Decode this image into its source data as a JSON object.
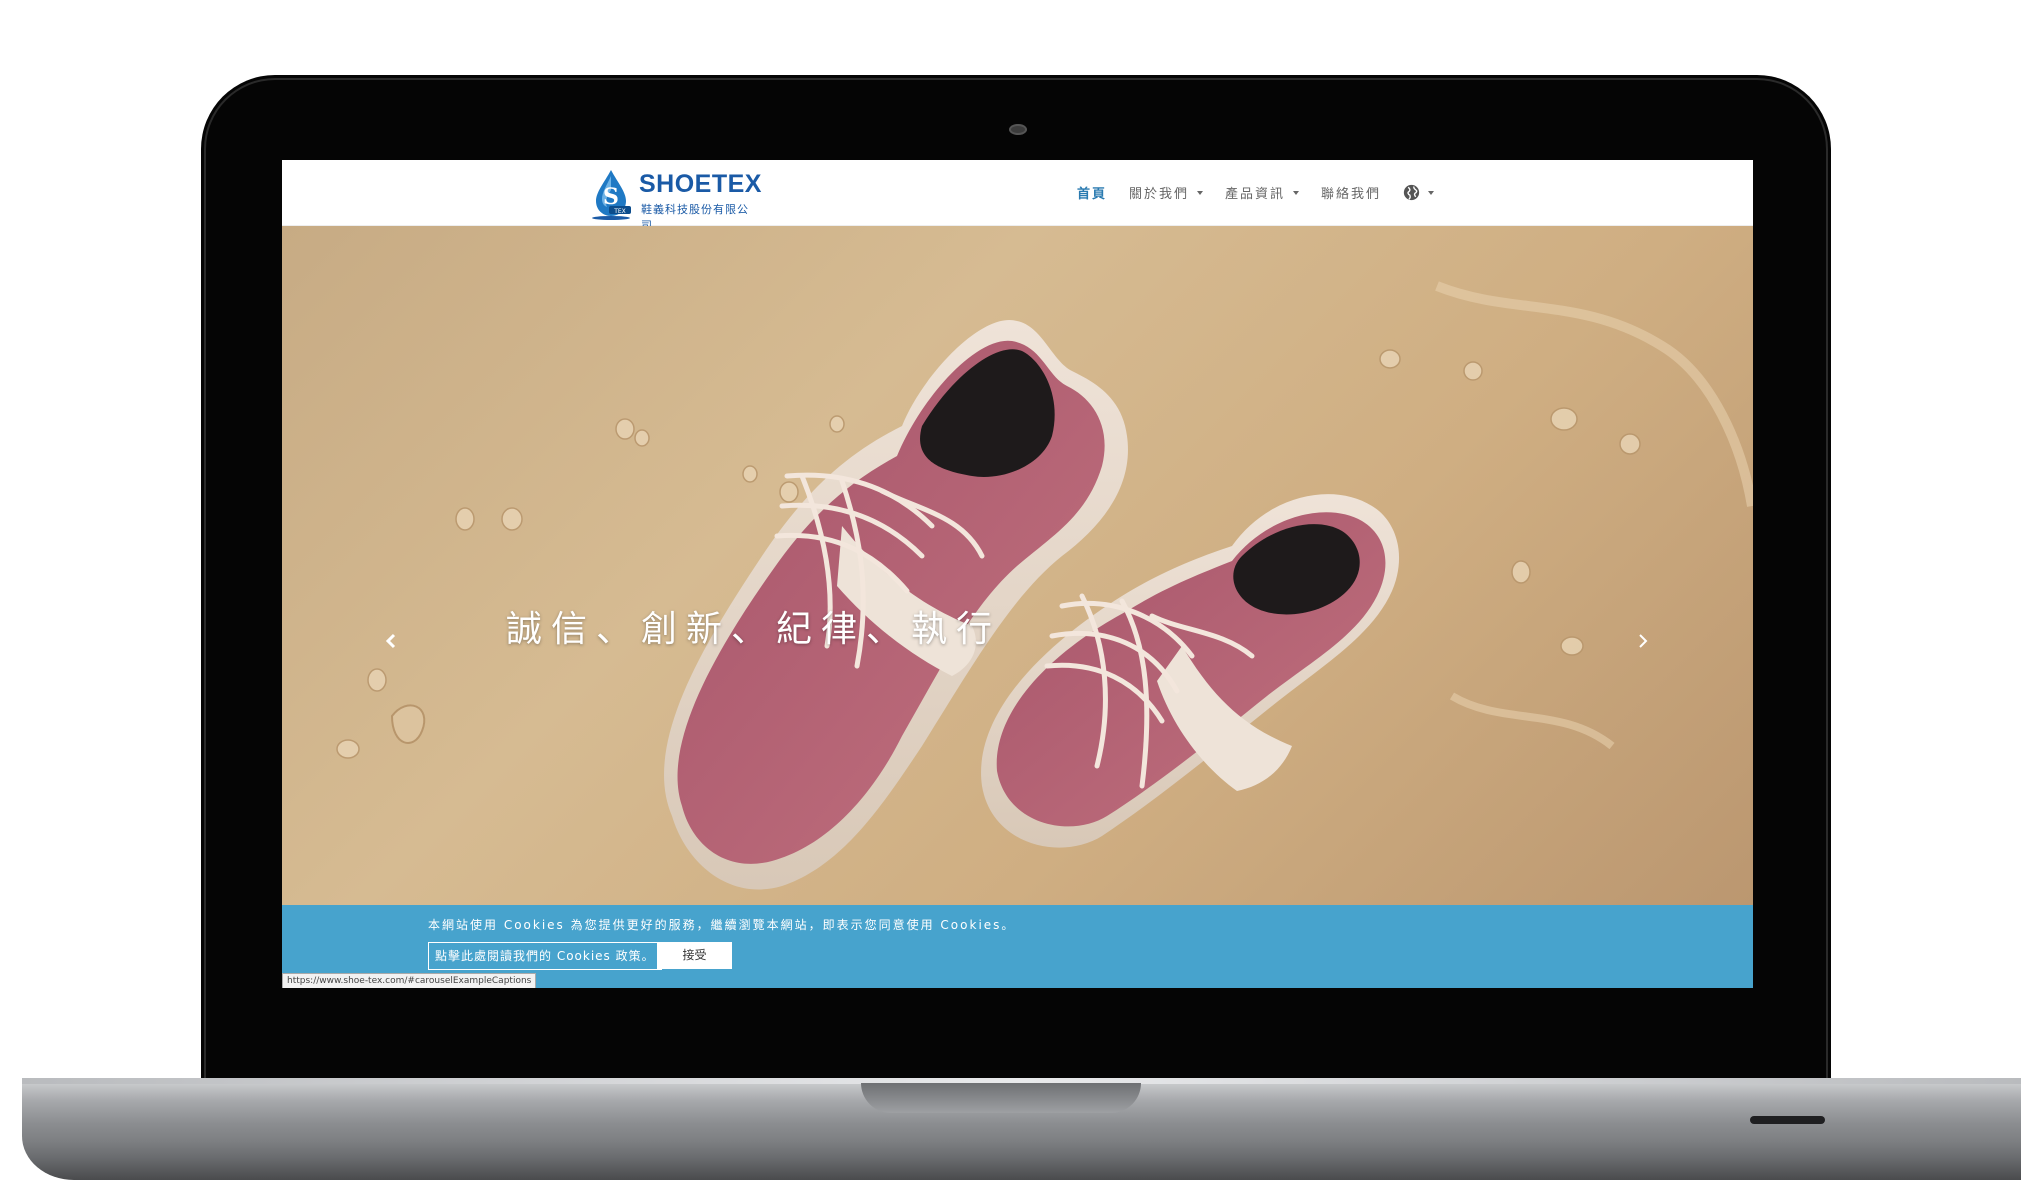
{
  "site": {
    "brand": "SHOETEX",
    "brand_sub": "鞋義科技股份有限公司"
  },
  "nav": {
    "items": [
      {
        "label": "首頁",
        "active": true,
        "dropdown": false
      },
      {
        "label": "關於我們",
        "active": false,
        "dropdown": true
      },
      {
        "label": "產品資訊",
        "active": false,
        "dropdown": true
      },
      {
        "label": "聯絡我們",
        "active": false,
        "dropdown": false
      }
    ],
    "language_icon": "globe-icon"
  },
  "hero": {
    "caption": "誠信、創新、紀律、執行",
    "prev_icon": "chevron-left-icon",
    "next_icon": "chevron-right-icon"
  },
  "cookie": {
    "text": "本網站使用 Cookies 為您提供更好的服務，繼續瀏覽本網站，即表示您同意使用 Cookies。",
    "policy_label": "點擊此處閱讀我們的 Cookies 政策。",
    "accept_label": "接受"
  },
  "status_url": "https://www.shoe-tex.com/#carouselExampleCaptions",
  "colors": {
    "brand_blue": "#1a5aa6",
    "nav_active": "#2a7ab0",
    "cookie_bg": "#47a3cd",
    "bezel": "#050505"
  }
}
